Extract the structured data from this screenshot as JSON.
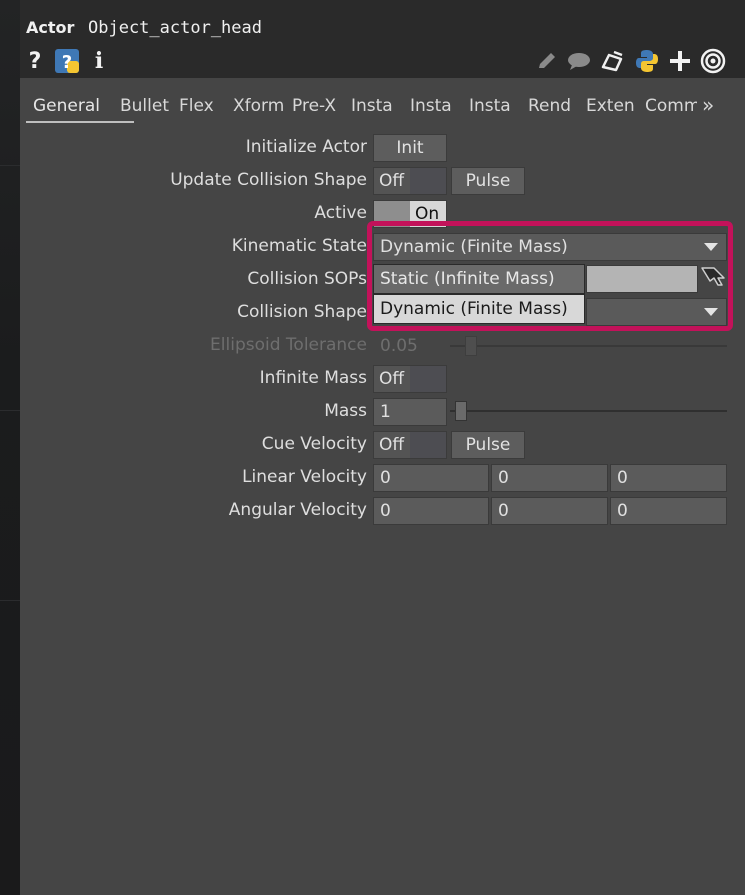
{
  "header": {
    "op_type": "Actor",
    "op_name": "Object_actor_head"
  },
  "icons": {
    "help": "question-mark-icon",
    "python_help": "python-help-icon",
    "info": "info-icon",
    "edit": "pencil-icon",
    "comment": "comment-bubble-icon",
    "clone": "clone-icon",
    "python": "python-icon",
    "add": "plus-icon",
    "target": "target-icon"
  },
  "tabs": [
    {
      "label": "General"
    },
    {
      "label": "Bullet"
    },
    {
      "label": "Flex"
    },
    {
      "label": "Xform"
    },
    {
      "label": "Pre-X"
    },
    {
      "label": "Insta"
    },
    {
      "label": "Insta"
    },
    {
      "label": "Insta"
    },
    {
      "label": "Rend"
    },
    {
      "label": "Exten"
    },
    {
      "label": "Comm"
    },
    {
      "label": "»"
    }
  ],
  "params": {
    "initialize_actor": {
      "label": "Initialize Actor",
      "button": "Init"
    },
    "update_collision_shape": {
      "label": "Update Collision Shape",
      "state": "Off",
      "button": "Pulse"
    },
    "active": {
      "label": "Active",
      "state": "On"
    },
    "kinematic_state": {
      "label": "Kinematic State",
      "value": "Dynamic (Finite Mass)"
    },
    "collision_sops": {
      "label": "Collision SOPs"
    },
    "collision_shape": {
      "label": "Collision Shape"
    },
    "ellipsoid_tolerance": {
      "label": "Ellipsoid Tolerance",
      "value": "0.05"
    },
    "infinite_mass": {
      "label": "Infinite Mass",
      "state": "Off"
    },
    "mass": {
      "label": "Mass",
      "value": "1"
    },
    "cue_velocity": {
      "label": "Cue Velocity",
      "state": "Off",
      "button": "Pulse"
    },
    "linear_velocity": {
      "label": "Linear Velocity",
      "x": "0",
      "y": "0",
      "z": "0"
    },
    "angular_velocity": {
      "label": "Angular Velocity",
      "x": "0",
      "y": "0",
      "z": "0"
    }
  },
  "dropdown_menu": {
    "options": [
      "Static (Infinite Mass)",
      "Dynamic (Finite Mass)"
    ]
  },
  "colors": {
    "highlight": "#c3125a",
    "panel_bg": "#454545",
    "header_bg": "#2a2a2a"
  }
}
